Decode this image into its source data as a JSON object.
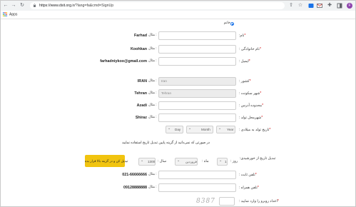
{
  "browser": {
    "url_host": "https://www.dsit.org.ir",
    "url_path": "/?lang=fa&cmd=SignUp",
    "profile_initial": "F",
    "bookmarks_apps_label": "Apps"
  },
  "form": {
    "gender_option": "خانم",
    "fields": [
      {
        "key": "first_name",
        "label": "نام:",
        "value": "Farhad",
        "example": "مثال :",
        "required": true
      },
      {
        "key": "last_name",
        "label": "نام خانوادگی :",
        "value": "Koohkan",
        "example": "مثال :",
        "required": true
      },
      {
        "key": "email",
        "label": "ایمیل :",
        "value": "farhadniykoo@gmail.com",
        "example": "مثال :",
        "required": true
      },
      {
        "key": "country",
        "label": "کشور :",
        "value": "IRAN",
        "example": "مثال :",
        "required": true,
        "input_value": "Iran"
      },
      {
        "key": "city",
        "label": "شهر سکونت :",
        "value": "Tehran",
        "example": "مثال :",
        "required": true,
        "input_value": "Tehran"
      },
      {
        "key": "district",
        "label": "محدوده آدرس :",
        "value": "Azadi",
        "example": "مثال :",
        "required": true
      },
      {
        "key": "birth_city",
        "label": "شهرمحل تولد :",
        "value": "Shiraz",
        "example": "مثال :",
        "required": true
      }
    ],
    "birthdate": {
      "label": "تاریخ تولد به میلادی :",
      "required": true,
      "day": "Day",
      "month": "Month",
      "year": "Year"
    },
    "convert_note": "در صورتی که نمی‌دانید از گزینه پایین تبدیل تاریخ استفاده نمایید",
    "shamsi": {
      "label": "تبدیل تاریخ از خورشیدی:",
      "day_label": "روز :",
      "day_value": "1",
      "month_label": "ماه :",
      "month_value": "فروردین",
      "year_label": "سال :",
      "year_value": "1300",
      "button": "تبدیل کن و در گزینه بالا قرار بده"
    },
    "phone": {
      "label": "تلفن ثابت :",
      "value": "021-66666666",
      "example": "مثال :",
      "required": true
    },
    "mobile": {
      "label": "تلفن همراه :",
      "value": "09128888888",
      "example": "مثال :",
      "required": true
    },
    "captcha": {
      "label": "اعداد روبرو را وارد نمایید :",
      "code": "8387",
      "required": true
    }
  }
}
